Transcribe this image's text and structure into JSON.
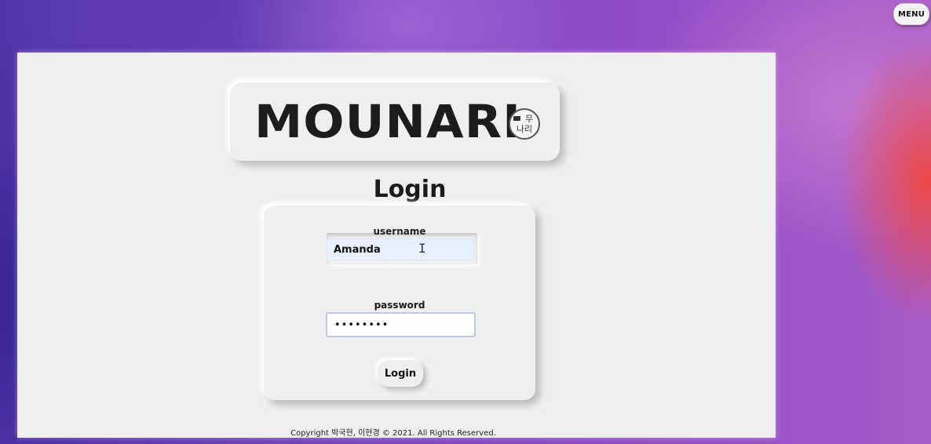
{
  "menu": {
    "label": "MENU"
  },
  "logo": {
    "text": "MOUNARI",
    "badge_line1": "무",
    "badge_line2": "나리",
    "badge_icon": "camera-icon"
  },
  "login": {
    "title": "Login",
    "username_label": "username",
    "username_value": "Amanda",
    "password_label": "password",
    "password_value": "••••••••",
    "button_label": "Login"
  },
  "footer": {
    "copyright": "Copyright 박국현, 이현경 © 2021. All Rights Reserved."
  },
  "colors": {
    "panel_bg": "#efefef",
    "autofill_bg": "#e8f0fe",
    "focus_border": "#b8c9ea",
    "background_purple": "#7c47c2",
    "background_red": "#f24840"
  },
  "cursor": {
    "icon": "text-cursor-icon"
  }
}
